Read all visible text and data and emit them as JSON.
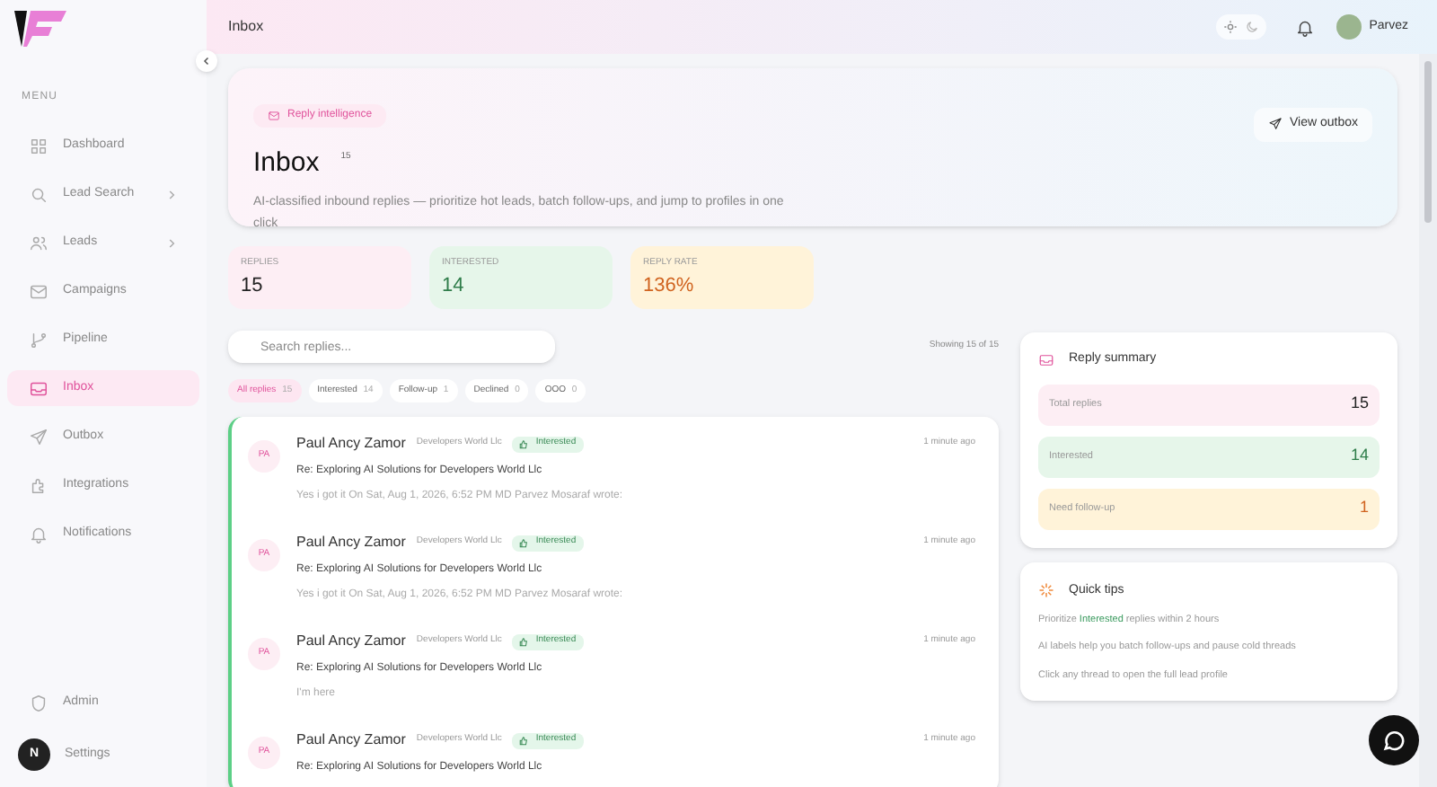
{
  "sidebar": {
    "section_label": "MENU",
    "items": [
      {
        "label": "Dashboard",
        "selected": false,
        "has_submenu": false
      },
      {
        "label": "Lead Search",
        "selected": false,
        "has_submenu": true
      },
      {
        "label": "Leads",
        "selected": false,
        "has_submenu": true
      },
      {
        "label": "Campaigns",
        "selected": false,
        "has_submenu": false
      },
      {
        "label": "Pipeline",
        "selected": false,
        "has_submenu": false
      },
      {
        "label": "Inbox",
        "selected": true,
        "has_submenu": false
      },
      {
        "label": "Outbox",
        "selected": false,
        "has_submenu": false
      },
      {
        "label": "Integrations",
        "selected": false,
        "has_submenu": false
      },
      {
        "label": "Notifications",
        "selected": false,
        "has_submenu": false
      }
    ],
    "bottom_items": [
      {
        "label": "Admin"
      },
      {
        "label": "Settings"
      }
    ],
    "avatar_letter": "N"
  },
  "topbar": {
    "title": "Inbox",
    "dark_mode": false,
    "user": "Parvez"
  },
  "hero": {
    "badge": "Reply intelligence",
    "title": "Inbox",
    "count": "15",
    "description": "AI-classified inbound replies — prioritize hot leads, batch follow-ups, and jump to profiles in one click",
    "action": "View outbox"
  },
  "stats": [
    {
      "label": "REPLIES",
      "value": "15"
    },
    {
      "label": "INTERESTED",
      "value": "14"
    },
    {
      "label": "REPLY RATE",
      "value": "136%"
    }
  ],
  "search": {
    "placeholder": "Search replies..."
  },
  "showing": "Showing 15 of 15",
  "filters": [
    {
      "label": "All replies",
      "count": "15",
      "selected": true
    },
    {
      "label": "Interested",
      "count": "14",
      "selected": false
    },
    {
      "label": "Follow-up",
      "count": "1",
      "selected": false
    },
    {
      "label": "Declined",
      "count": "0",
      "selected": false
    },
    {
      "label": "OOO",
      "count": "0",
      "selected": false
    }
  ],
  "messages": [
    {
      "initials": "PA",
      "name": "Paul Ancy Zamor",
      "company": "Developers World Llc",
      "tag": "Interested",
      "time": "1 minute ago",
      "subject": "Re: Exploring AI Solutions for Developers World Llc",
      "preview": "Yes i got it On Sat, Aug 1, 2026, 6:52 PM MD Parvez Mosaraf wrote:"
    },
    {
      "initials": "PA",
      "name": "Paul Ancy Zamor",
      "company": "Developers World Llc",
      "tag": "Interested",
      "time": "1 minute ago",
      "subject": "Re: Exploring AI Solutions for Developers World Llc",
      "preview": "Yes i got it On Sat, Aug 1, 2026, 6:52 PM MD Parvez Mosaraf wrote:"
    },
    {
      "initials": "PA",
      "name": "Paul Ancy Zamor",
      "company": "Developers World Llc",
      "tag": "Interested",
      "time": "1 minute ago",
      "subject": "Re: Exploring AI Solutions for Developers World Llc",
      "preview": "I'm here"
    },
    {
      "initials": "PA",
      "name": "Paul Ancy Zamor",
      "company": "Developers World Llc",
      "tag": "Interested",
      "time": "1 minute ago",
      "subject": "Re: Exploring AI Solutions for Developers World Llc"
    }
  ],
  "summary": {
    "title": "Reply summary",
    "rows": [
      {
        "label": "Total replies",
        "value": "15"
      },
      {
        "label": "Interested",
        "value": "14"
      },
      {
        "label": "Need follow-up",
        "value": "1"
      }
    ]
  },
  "tips": {
    "title": "Quick tips",
    "items": [
      [
        {
          "text": "Prioritize ",
          "highlight": false
        },
        {
          "text": "Interested",
          "highlight": true
        },
        {
          "text": " replies within 2 hours",
          "highlight": false
        }
      ],
      [
        {
          "text": "AI labels help you batch follow-ups and pause cold threads",
          "highlight": false
        }
      ],
      [
        {
          "text": "Click any thread to open the full lead profile",
          "highlight": false
        }
      ]
    ]
  }
}
